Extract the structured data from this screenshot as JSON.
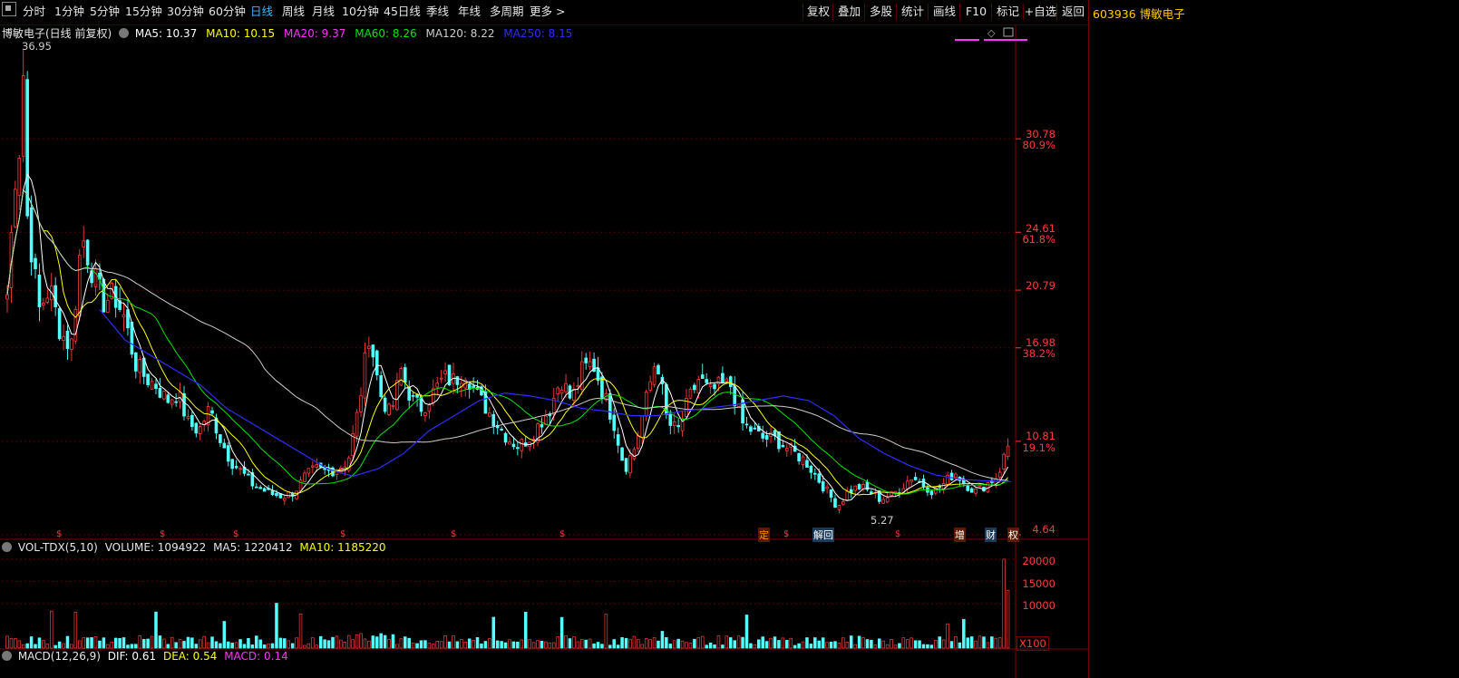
{
  "toolbar": {
    "periods": [
      "分时",
      "1分钟",
      "5分钟",
      "15分钟",
      "30分钟",
      "60分钟",
      "日线",
      "周线",
      "月线",
      "10分钟",
      "45日线",
      "季线",
      "年线",
      "多周期",
      "更多 >"
    ],
    "active_period": "日线",
    "tools": [
      "复权",
      "叠加",
      "多股",
      "统计",
      "画线",
      "F10",
      "标记",
      "+自选",
      "返回"
    ]
  },
  "stock": {
    "code_name": "603936 博敏电子",
    "chart_title": "博敏电子(日线 前复权)"
  },
  "ma_legend": {
    "ma5": "MA5: 10.37",
    "ma10": "MA10: 10.15",
    "ma20": "MA20: 9.37",
    "ma60": "MA60: 8.26",
    "ma120": "MA120: 8.22",
    "ma250": "MA250: 8.15"
  },
  "price_axis": {
    "levels": [
      "30.78",
      "24.61",
      "20.79",
      "16.98",
      "10.81",
      "4.64"
    ],
    "pct": [
      "80.9%",
      "61.8%",
      "38.2%",
      "19.1%"
    ],
    "high_label": "36.95",
    "low_label": "5.27"
  },
  "event_marks": [
    "定",
    "解回",
    "增",
    "财",
    "权"
  ],
  "volume": {
    "title": "VOL-TDX(5,10)",
    "volume": "VOLUME: 1094922",
    "ma5": "MA5: 1220412",
    "ma10": "MA10: 1185220",
    "axis": [
      "20000",
      "15000",
      "10000"
    ],
    "unit": "X100"
  },
  "macd": {
    "title": "MACD(12,26,9)",
    "dif": "DIF: 0.61",
    "dea": "DEA: 0.54",
    "macd": "MACD: 0.14"
  },
  "colors": {
    "up": "#ff3b3b",
    "down": "#54ffff",
    "ma5": "#ffffff",
    "ma10": "#ffff00",
    "ma20": "#ff33ff",
    "ma60": "#00e600",
    "ma120": "#cccccc",
    "ma250": "#2d2dff"
  },
  "chart_data": {
    "type": "candlestick",
    "title": "博敏电子(日线 前复权)",
    "ylim": [
      4.64,
      36.95
    ],
    "yticks": [
      30.78,
      24.61,
      20.79,
      16.98,
      10.81,
      4.64
    ],
    "percent_levels": {
      "80.9%": 30.78,
      "61.8%": 24.61,
      "38.2%": 16.98,
      "19.1%": 10.81
    },
    "high": 36.95,
    "low": 5.27,
    "close_trend": [
      20.5,
      31.0,
      25.0,
      19.5,
      21.0,
      18.0,
      17.0,
      24.5,
      22.0,
      20.0,
      20.5,
      19.0,
      16.0,
      15.0,
      14.5,
      13.5,
      14.0,
      12.0,
      11.5,
      13.0,
      11.0,
      9.5,
      8.8,
      8.0,
      7.6,
      7.3,
      7.2,
      7.5,
      8.5,
      9.0,
      8.8,
      9.0,
      9.5,
      13.0,
      18.0,
      14.0,
      12.5,
      15.5,
      13.5,
      13.0,
      14.0,
      15.0,
      14.8,
      15.5,
      14.0,
      13.0,
      12.0,
      11.0,
      10.5,
      11.0,
      12.0,
      13.0,
      15.0,
      13.5,
      15.5,
      16.0,
      14.0,
      12.0,
      9.0,
      10.5,
      13.5,
      16.5,
      12.0,
      11.5,
      13.5,
      15.0,
      14.0,
      14.5,
      14.5,
      12.0,
      11.5,
      11.0,
      11.0,
      10.5,
      10.0,
      9.5,
      8.5,
      7.5,
      6.5,
      7.5,
      7.8,
      7.5,
      7.0,
      7.2,
      7.8,
      8.5,
      8.0,
      7.5,
      8.0,
      8.8,
      8.0,
      7.5,
      8.0,
      8.5,
      10.5
    ],
    "ma_lines": {
      "MA20": [
        21.0,
        21.5,
        20.0,
        18.5,
        17.5,
        16.0,
        14.5,
        13.5,
        13.0,
        12.0,
        10.5,
        9.5,
        8.5,
        7.8,
        8.0,
        9.0,
        12.0,
        14.0,
        13.5,
        14.0,
        14.5,
        14.0,
        12.5,
        11.0,
        12.5,
        14.5,
        12.0,
        12.5,
        14.0,
        13.0,
        11.5,
        10.5,
        9.5,
        8.0,
        7.2,
        7.8,
        8.2,
        8.0,
        8.0,
        8.3
      ],
      "MA250": [
        19.5,
        17.5,
        16.5,
        15.5,
        14.5,
        13.0,
        12.0,
        11.0,
        10.0,
        9.0,
        8.5,
        9.0,
        10.0,
        11.5,
        12.5,
        13.5,
        14.0,
        13.8,
        13.5,
        13.0,
        12.8,
        12.5,
        12.5,
        12.8,
        13.0,
        13.2,
        13.5,
        13.8,
        13.5,
        12.5,
        11.0,
        10.0,
        9.2,
        8.6,
        8.3,
        8.2,
        8.15
      ]
    },
    "volume_ylim": [
      0,
      21000
    ],
    "volume_yticks": [
      20000,
      15000,
      10000
    ]
  }
}
